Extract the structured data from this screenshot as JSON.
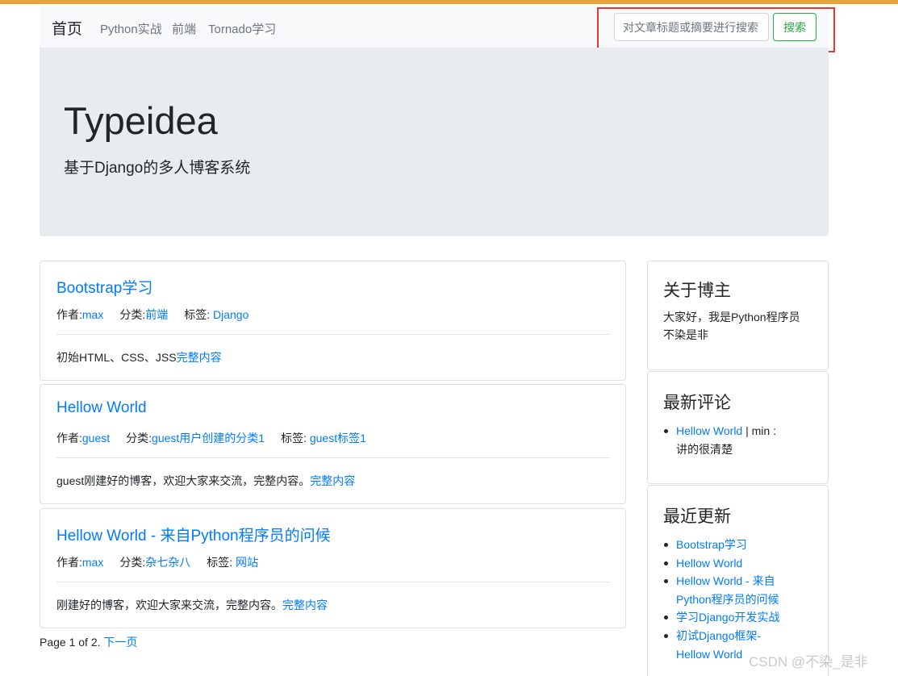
{
  "navbar": {
    "brand": "首页",
    "links": [
      "Python实战",
      "前端",
      "Tornado学习"
    ],
    "search_placeholder": "对文章标题或摘要进行搜索",
    "search_button": "搜索"
  },
  "jumbotron": {
    "title": "Typeidea",
    "subtitle": "基于Django的多人博客系统"
  },
  "posts": [
    {
      "title": "Bootstrap学习",
      "author_label": "作者:",
      "author": "max",
      "category_label": "分类:",
      "category": "前端",
      "tag_label": "标签: ",
      "tag": "Django",
      "desc": "初始HTML、CSS、JSS",
      "more": "完整内容"
    },
    {
      "title": "Hellow World",
      "author_label": "作者:",
      "author": "guest",
      "category_label": "分类:",
      "category": "guest用户创建的分类1",
      "tag_label": "标签: ",
      "tag": "guest标签1",
      "desc": "guest刚建好的博客，欢迎大家来交流，完整内容。",
      "more": "完整内容"
    },
    {
      "title": "Hellow World - 来自Python程序员的问候",
      "author_label": "作者:",
      "author": "max",
      "category_label": "分类:",
      "category": "杂七杂八",
      "tag_label": "标签: ",
      "tag": "网站",
      "desc": "刚建好的博客，欢迎大家来交流，完整内容。",
      "more": "完整内容"
    }
  ],
  "pagination": {
    "text": "Page 1 of 2.",
    "next": "下一页"
  },
  "sidebar": {
    "about": {
      "title": "关于博主",
      "lines": [
        "大家好，我是Python程序员",
        "不染是非"
      ]
    },
    "comments": {
      "title": "最新评论",
      "link": "Hellow World",
      "sep": " | min :",
      "text": "讲的很清楚"
    },
    "recent": {
      "title": "最近更新",
      "items": [
        [
          "Bootstrap学习"
        ],
        [
          "Hellow World"
        ],
        [
          "Hellow World - 来自",
          "Python程序员的问候"
        ],
        [
          "学习Django开发实战"
        ],
        [
          "初试Django框架-",
          "Hellow World"
        ]
      ]
    }
  },
  "watermark": "CSDN @不染_是非",
  "colors": {
    "link": "#007bff",
    "success": "#28a745",
    "highlight": "#e53935",
    "accent_bar": "#e8a33a"
  }
}
